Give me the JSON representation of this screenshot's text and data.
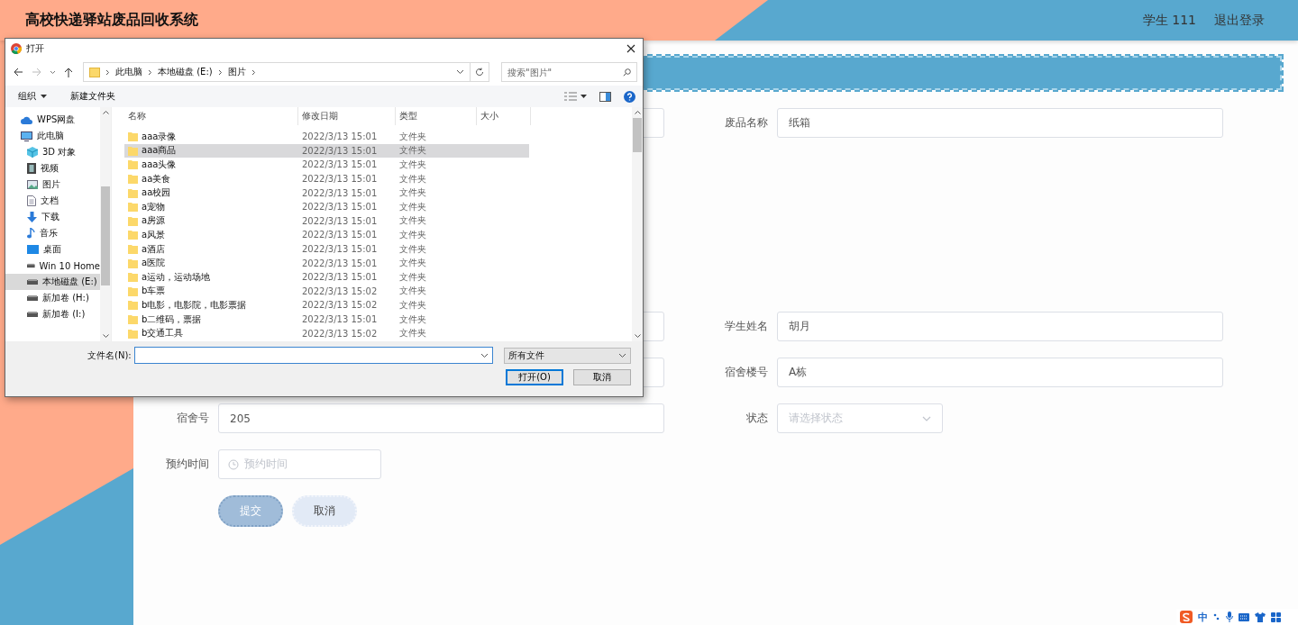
{
  "header": {
    "title": "高校快递驿站废品回收系统",
    "user": "学生 111",
    "logout": "退出登录"
  },
  "form": {
    "rows": [
      {
        "fields": [
          {
            "kind": "text"
          },
          {
            "kind": "text",
            "label": "废品名称",
            "value": "纸箱"
          }
        ]
      },
      {
        "fields": [
          {
            "kind": "text"
          },
          {
            "kind": "text",
            "label": "学生姓名",
            "value": "胡月"
          }
        ]
      },
      {
        "fields": [
          {
            "kind": "text"
          },
          {
            "kind": "text",
            "label": "宿舍楼号",
            "value": "A栋"
          }
        ]
      },
      {
        "fields": [
          {
            "kind": "text",
            "label": "宿舍号",
            "value": "205"
          },
          {
            "kind": "select",
            "label": "状态",
            "placeholder": "请选择状态"
          }
        ]
      },
      {
        "fields": [
          {
            "kind": "time",
            "label": "预约时间",
            "placeholder": "预约时间"
          }
        ]
      }
    ],
    "buttons": [
      {
        "label": "提交",
        "kind": "primary"
      },
      {
        "label": "取消",
        "kind": "secondary"
      }
    ]
  },
  "dialog": {
    "title": "打开",
    "path": [
      "此电脑",
      "本地磁盘 (E:)",
      "图片"
    ],
    "search_placeholder": "搜索\"图片\"",
    "organize": "组织",
    "new_folder": "新建文件夹",
    "nav": [
      {
        "label": "WPS网盘",
        "kind": "cloud",
        "selected": false
      },
      {
        "label": "此电脑",
        "kind": "pc",
        "selected": false,
        "children": [
          {
            "label": "3D 对象",
            "kind": "cube",
            "selected": false
          },
          {
            "label": "视频",
            "kind": "video",
            "selected": false
          },
          {
            "label": "图片",
            "kind": "pictures",
            "selected": false
          },
          {
            "label": "文档",
            "kind": "docs",
            "selected": false
          },
          {
            "label": "下载",
            "kind": "download",
            "selected": false
          },
          {
            "label": "音乐",
            "kind": "music",
            "selected": false
          },
          {
            "label": "桌面",
            "kind": "desktop",
            "selected": false
          },
          {
            "label": "Win 10 Home",
            "kind": "drive",
            "selected": false
          },
          {
            "label": "本地磁盘 (E:)",
            "kind": "drive",
            "selected": true
          },
          {
            "label": "新加卷 (H:)",
            "kind": "drive",
            "selected": false
          },
          {
            "label": "新加卷 (I:)",
            "kind": "drive",
            "selected": false
          }
        ]
      }
    ],
    "columns": [
      "名称",
      "修改日期",
      "类型",
      "大小"
    ],
    "files": [
      {
        "name": "aaa录像",
        "date": "2022/3/13 15:01",
        "type": "文件夹",
        "selected": false
      },
      {
        "name": "aaa商品",
        "date": "2022/3/13 15:01",
        "type": "文件夹",
        "selected": true
      },
      {
        "name": "aaa头像",
        "date": "2022/3/13 15:01",
        "type": "文件夹",
        "selected": false
      },
      {
        "name": "aa美食",
        "date": "2022/3/13 15:01",
        "type": "文件夹",
        "selected": false
      },
      {
        "name": "aa校园",
        "date": "2022/3/13 15:01",
        "type": "文件夹",
        "selected": false
      },
      {
        "name": "a宠物",
        "date": "2022/3/13 15:01",
        "type": "文件夹",
        "selected": false
      },
      {
        "name": "a房源",
        "date": "2022/3/13 15:01",
        "type": "文件夹",
        "selected": false
      },
      {
        "name": "a风景",
        "date": "2022/3/13 15:01",
        "type": "文件夹",
        "selected": false
      },
      {
        "name": "a酒店",
        "date": "2022/3/13 15:01",
        "type": "文件夹",
        "selected": false
      },
      {
        "name": "a医院",
        "date": "2022/3/13 15:01",
        "type": "文件夹",
        "selected": false
      },
      {
        "name": "a运动，运动场地",
        "date": "2022/3/13 15:01",
        "type": "文件夹",
        "selected": false
      },
      {
        "name": "b车票",
        "date": "2022/3/13 15:02",
        "type": "文件夹",
        "selected": false
      },
      {
        "name": "b电影，电影院，电影票据",
        "date": "2022/3/13 15:02",
        "type": "文件夹",
        "selected": false
      },
      {
        "name": "b二维码，票据",
        "date": "2022/3/13 15:01",
        "type": "文件夹",
        "selected": false
      },
      {
        "name": "b交通工具",
        "date": "2022/3/13 15:02",
        "type": "文件夹",
        "selected": false
      }
    ],
    "filename_label": "文件名(N):",
    "filetype": "所有文件",
    "open": "打开(O)",
    "cancel": "取消"
  },
  "ime": {
    "mode": "中"
  }
}
